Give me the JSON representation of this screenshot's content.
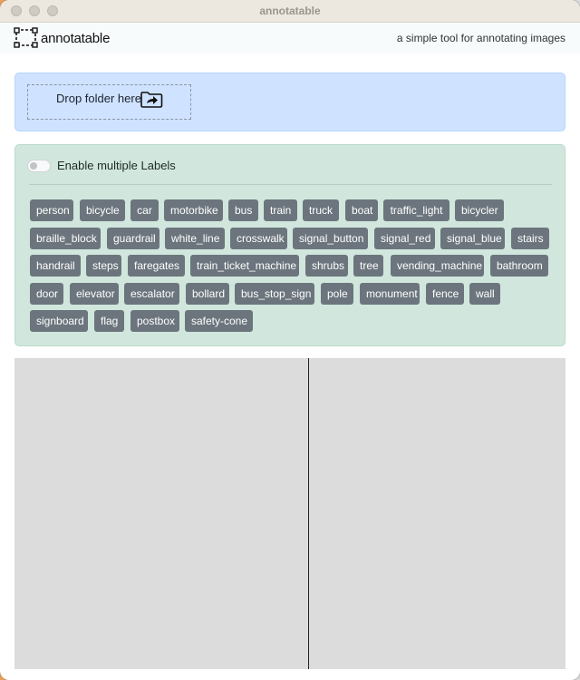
{
  "window": {
    "title": "annotatable"
  },
  "header": {
    "app_name": "annotatable",
    "tagline": "a simple tool for annotating images"
  },
  "dropzone": {
    "label": "Drop folder here",
    "icon": "folder-open-icon"
  },
  "labels_panel": {
    "toggle_label": "Enable multiple Labels",
    "toggle_on": false,
    "chips": [
      "person",
      "bicycle",
      "car",
      "motorbike",
      "bus",
      "train",
      "truck",
      "boat",
      "traffic_light",
      "bicycler",
      "braille_block",
      "guardrail",
      "white_line",
      "crosswalk",
      "signal_button",
      "signal_red",
      "signal_blue",
      "stairs",
      "handrail",
      "steps",
      "faregates",
      "train_ticket_machine",
      "shrubs",
      "tree",
      "vending_machine",
      "bathroom",
      "door",
      "elevator",
      "escalator",
      "bollard",
      "bus_stop_sign",
      "pole",
      "monument",
      "fence",
      "wall",
      "signboard",
      "flag",
      "postbox",
      "safety-cone"
    ]
  },
  "colors": {
    "drop_bg": "#cfe2ff",
    "labels_bg": "#d1e7dd",
    "chip_bg": "#6c757d",
    "canvas_bg": "#dcdcdc"
  }
}
